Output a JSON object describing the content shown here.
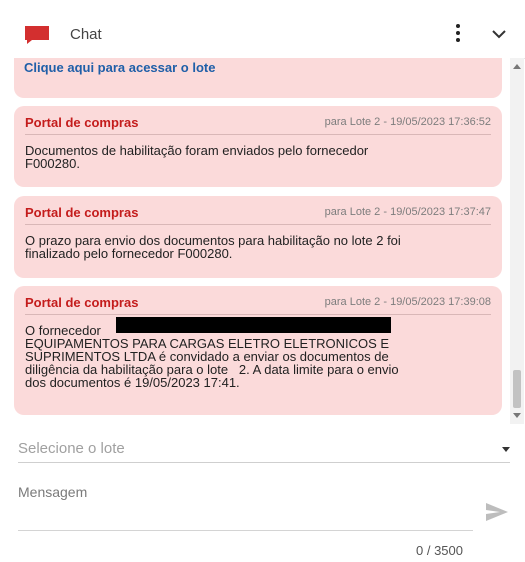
{
  "header": {
    "title": "Chat",
    "icon": "chat-bubble-icon",
    "accent_color": "#d32f2f"
  },
  "messages": {
    "top_link": "Clique aqui para acessar o lote",
    "items": [
      {
        "sender": "Portal de compras",
        "meta": "para Lote 2  -  19/05/2023 17:36:52",
        "text": "Documentos de habilitação foram enviados pelo fornecedor\nF000280."
      },
      {
        "sender": "Portal de compras",
        "meta": "para Lote 2  -  19/05/2023 17:37:47",
        "text": "O prazo para envio dos documentos para habilitação no lote 2 foi\nfinalizado pelo fornecedor F000280."
      },
      {
        "sender": "Portal de compras",
        "meta": "para Lote 2  -  19/05/2023 17:39:08",
        "text": "O fornecedor\nEQUIPAMENTOS PARA CARGAS ELETRO ELETRONICOS E\nSUPRIMENTOS LTDA é convidado a enviar os documentos de\ndiligência da habilitação para o lote   2. A data limite para o envio\ndos documentos é 19/05/2023 17:41."
      }
    ]
  },
  "composer": {
    "lote_placeholder": "Selecione o lote",
    "message_placeholder": "Mensagem",
    "counter": "0 / 3500"
  },
  "colors": {
    "bubble_bg": "#fbdada",
    "sender": "#c41c1c",
    "link": "#1f5fa8"
  }
}
